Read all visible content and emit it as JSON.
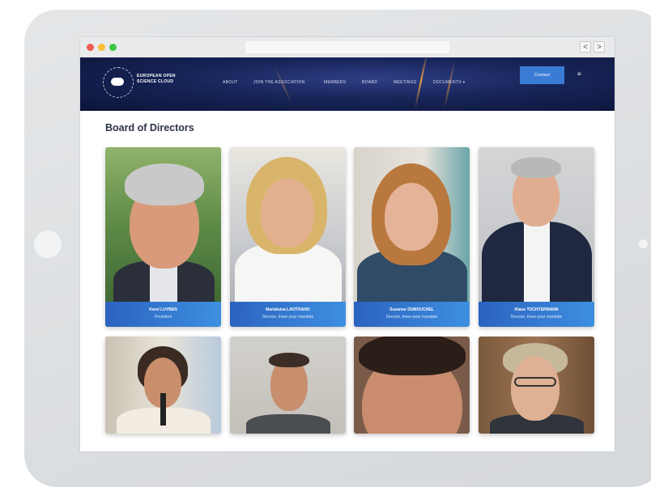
{
  "browser": {
    "back_label": "<",
    "forward_label": ">"
  },
  "header": {
    "logo_text": "EUROPEAN OPEN SCIENCE CLOUD",
    "nav": [
      "ABOUT",
      "JOIN THE ASSOCIATION",
      "MEMBERS",
      "BOARD",
      "MEETINGS",
      "DOCUMENTS ▾"
    ],
    "contact_label": "Contact",
    "menu_icon": "≡"
  },
  "page": {
    "title": "Board of Directors"
  },
  "board": [
    {
      "name": "Karel LUYBEN",
      "role": "President"
    },
    {
      "name": "Marialuisa LAVITRANO",
      "role": "Director, three-year mandate"
    },
    {
      "name": "Suzanne DUMOUCHEL",
      "role": "Director, three-year mandate"
    },
    {
      "name": "Klaus TOCHTERMANN",
      "role": "Director, three-year mandate"
    }
  ],
  "colors": {
    "header_bg": "#172458",
    "accent": "#3a7bd6",
    "caption_bg": "#2b63c0"
  },
  "icons": [
    "search-icon",
    "menu-icon"
  ]
}
